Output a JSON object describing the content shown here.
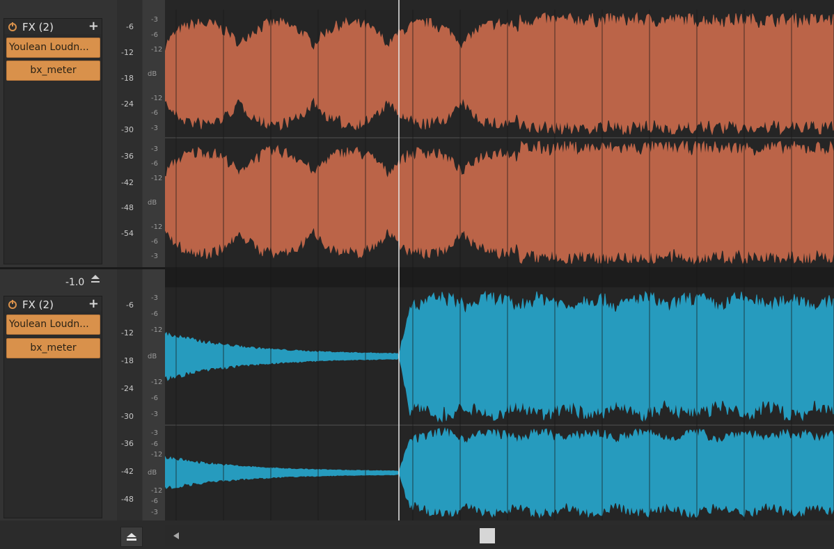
{
  "colors": {
    "track1_wave": "#c86a4c",
    "track2_wave": "#27a5cc",
    "plugin_bg": "#d9914b",
    "power_icon": "#d9914b"
  },
  "tracks": [
    {
      "fx_header": "FX (2)",
      "plugins": [
        "Youlean Loudn...",
        "bx_meter"
      ],
      "meter_ticks": [
        "-6",
        "-12",
        "-18",
        "-24",
        "-30",
        "-36",
        "-42",
        "-48",
        "-54"
      ]
    },
    {
      "volume_readout": "-1.0",
      "fx_header": "FX (2)",
      "plugins": [
        "Youlean Loudn...",
        "bx_meter"
      ],
      "meter_ticks": [
        "-6",
        "-12",
        "-18",
        "-24",
        "-30",
        "-36",
        "-42",
        "-48"
      ]
    }
  ],
  "waveform_scale_labels": [
    "-3",
    "-6",
    "-12",
    "dB",
    "-12",
    "-6",
    "-3"
  ],
  "icons": {
    "scroll_up": "up-triangle",
    "panel_toggle": "eject-icon",
    "scroll_left": "left-triangle"
  }
}
